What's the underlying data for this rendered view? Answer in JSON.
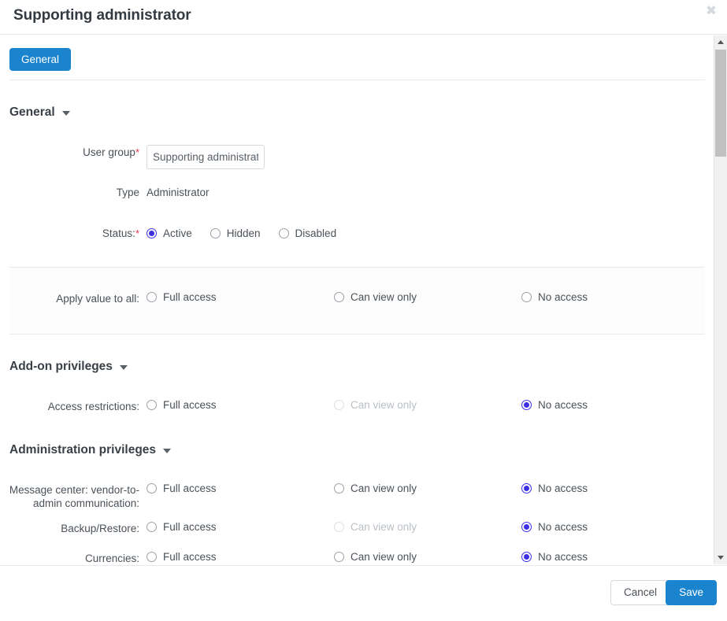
{
  "window": {
    "title": "Supporting administrator",
    "close_label": "✖"
  },
  "tabs": [
    {
      "label": "General",
      "active": true
    }
  ],
  "sections": {
    "general": {
      "title": "General",
      "fields": {
        "user_group": {
          "label": "User group",
          "required_marker": "*",
          "value": "Supporting administrator",
          "placeholder": ""
        },
        "type": {
          "label": "Type",
          "value": "Administrator"
        },
        "status": {
          "label": "Status:",
          "required_marker": "*",
          "options": [
            {
              "label": "Active",
              "checked": true,
              "disabled": false
            },
            {
              "label": "Hidden",
              "checked": false,
              "disabled": false
            },
            {
              "label": "Disabled",
              "checked": false,
              "disabled": false
            }
          ]
        }
      }
    },
    "apply_all": {
      "label": "Apply value to all:",
      "options": [
        {
          "label": "Full access",
          "checked": false,
          "disabled": false
        },
        {
          "label": "Can view only",
          "checked": false,
          "disabled": false
        },
        {
          "label": "No access",
          "checked": false,
          "disabled": false
        }
      ]
    },
    "addon": {
      "title": "Add-on privileges",
      "rows": [
        {
          "label": "Access restrictions:",
          "options": [
            {
              "label": "Full access",
              "checked": false,
              "disabled": false
            },
            {
              "label": "Can view only",
              "checked": false,
              "disabled": true
            },
            {
              "label": "No access",
              "checked": true,
              "disabled": false
            }
          ]
        }
      ]
    },
    "administration": {
      "title": "Administration privileges",
      "rows": [
        {
          "label": "Message center: vendor-to-admin communication:",
          "options": [
            {
              "label": "Full access",
              "checked": false,
              "disabled": false
            },
            {
              "label": "Can view only",
              "checked": false,
              "disabled": false
            },
            {
              "label": "No access",
              "checked": true,
              "disabled": false
            }
          ]
        },
        {
          "label": "Backup/Restore:",
          "options": [
            {
              "label": "Full access",
              "checked": false,
              "disabled": false
            },
            {
              "label": "Can view only",
              "checked": false,
              "disabled": true
            },
            {
              "label": "No access",
              "checked": true,
              "disabled": false
            }
          ]
        },
        {
          "label": "Currencies:",
          "options": [
            {
              "label": "Full access",
              "checked": false,
              "disabled": false
            },
            {
              "label": "Can view only",
              "checked": false,
              "disabled": false
            },
            {
              "label": "No access",
              "checked": true,
              "disabled": false
            }
          ]
        }
      ]
    }
  },
  "footer": {
    "cancel_label": "Cancel",
    "save_label": "Save"
  },
  "colors": {
    "accent_blue": "#1b84ce",
    "radio_selected": "#3d2fe3",
    "required_red": "#e8374a",
    "border": "#e7e9ec"
  }
}
